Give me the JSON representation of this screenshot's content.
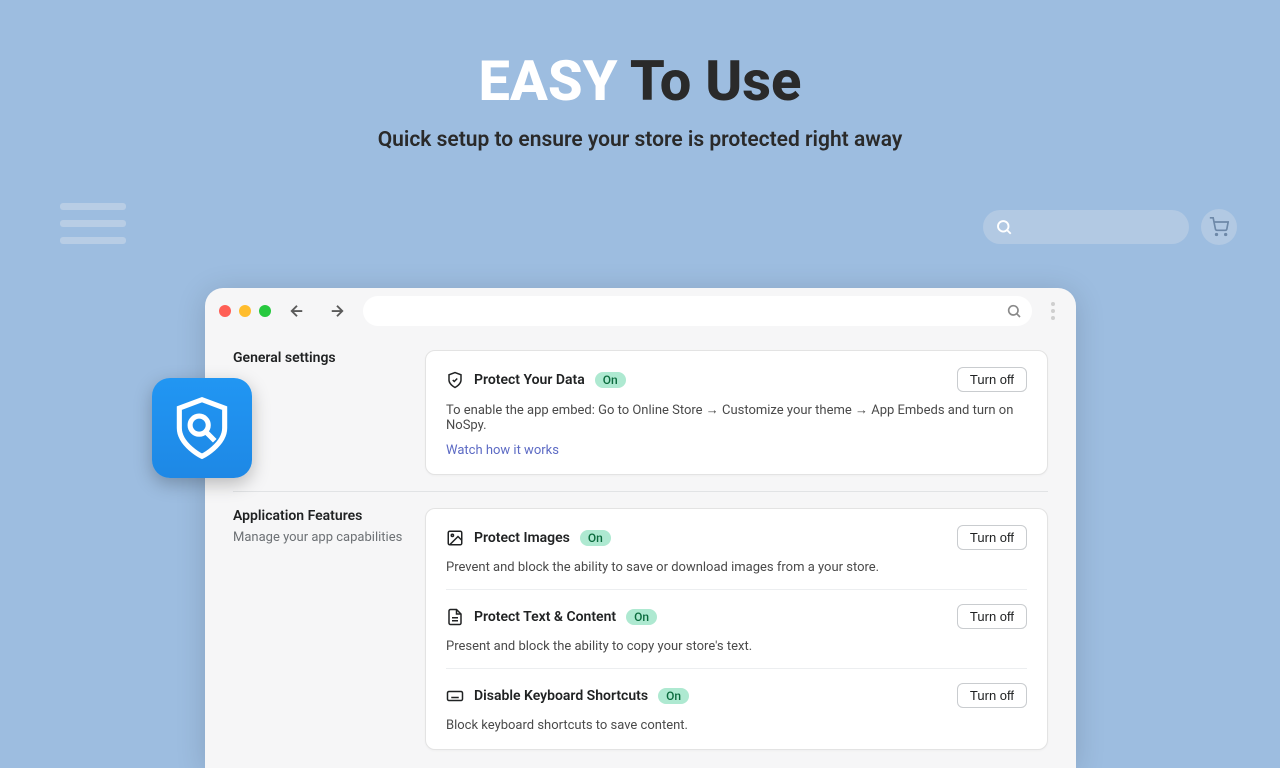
{
  "hero": {
    "title_easy": "EASY",
    "title_rest": " To Use",
    "subtitle": "Quick setup to ensure your store is protected right away"
  },
  "sidebar": {
    "general_heading": "General settings",
    "features_heading": "Application Features",
    "features_sub": "Manage your app capabilities"
  },
  "general_card": {
    "title": "Protect Your Data",
    "status": "On",
    "button": "Turn off",
    "description": "To enable the app embed: Go to Online Store → Customize your theme → App Embeds and turn on NoSpy.",
    "link": "Watch how it works"
  },
  "features": [
    {
      "icon": "image-icon",
      "title": "Protect Images",
      "status": "On",
      "button": "Turn off",
      "description": "Prevent and block the ability to save or download images from a your store."
    },
    {
      "icon": "file-text-icon",
      "title": "Protect Text & Content",
      "status": "On",
      "button": "Turn off",
      "description": "Present and block the ability to copy your store's text."
    },
    {
      "icon": "keyboard-icon",
      "title": "Disable Keyboard Shortcuts",
      "status": "On",
      "button": "Turn off",
      "description": "Block keyboard shortcuts to save content."
    }
  ]
}
